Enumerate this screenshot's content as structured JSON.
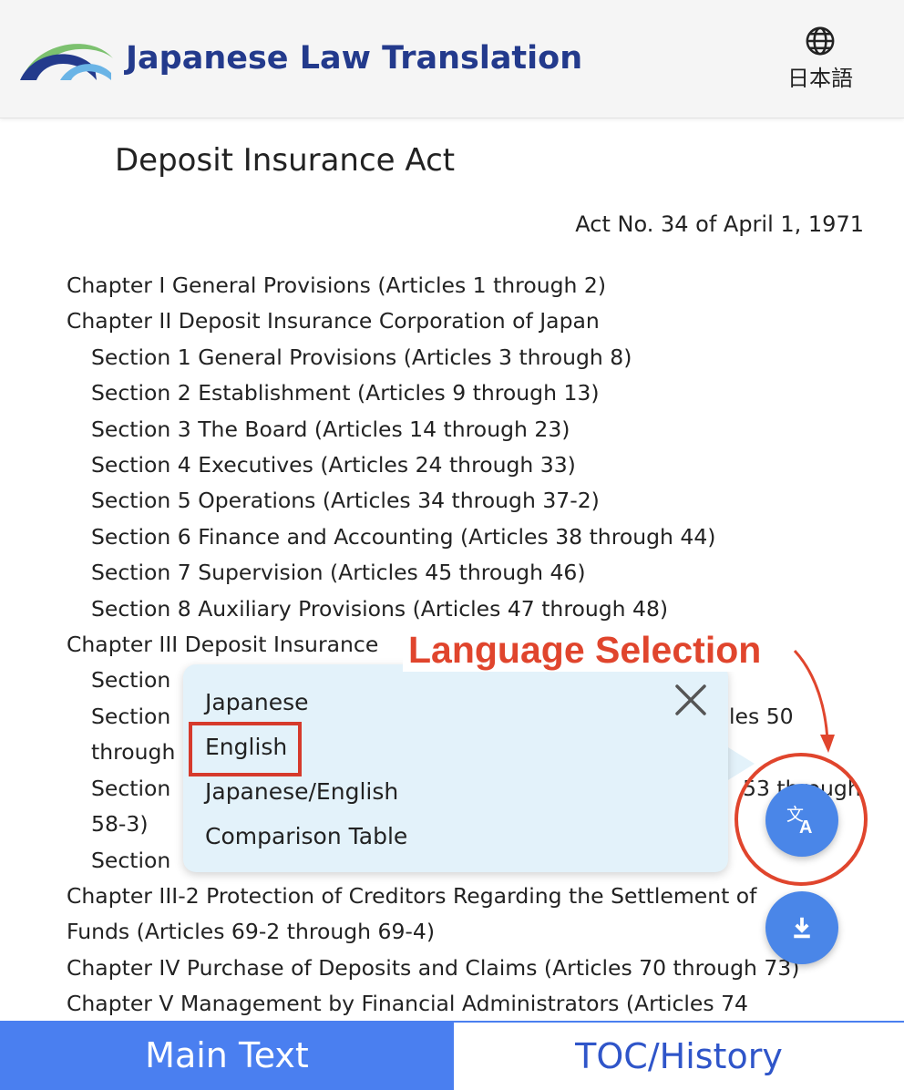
{
  "header": {
    "brand": "Japanese Law Translation",
    "language_link": "日本語",
    "logo_icon": "jlt-logo",
    "globe_icon": "globe-icon"
  },
  "document": {
    "title": "Deposit Insurance Act",
    "act_number": "Act No. 34 of April 1, 1971"
  },
  "toc": [
    "Chapter I General Provisions (Articles 1 through 2)",
    "Chapter II Deposit Insurance Corporation of Japan",
    "Section 1 General Provisions (Articles 3 through 8)",
    "Section 2 Establishment (Articles 9 through 13)",
    "Section 3 The Board (Articles 14 through 23)",
    "Section 4 Executives (Articles 24 through 33)",
    "Section 5 Operations (Articles 34 through 37-2)",
    "Section 6 Finance and Accounting (Articles 38 through 44)",
    "Section 7 Supervision (Articles 45 through 46)",
    "Section 8 Auxiliary Provisions (Articles 47 through 48)",
    "Chapter III Deposit Insurance",
    "Section",
    "Section",
    "les 50",
    "through",
    "Section",
    "53 through",
    "58-3)",
    "Section",
    "Chapter III-2 Protection of Creditors Regarding the Settlement of",
    "Funds (Articles 69-2 through 69-4)",
    "Chapter IV Purchase of Deposits and Claims (Articles 70 through 73)",
    "Chapter V Management by Financial Administrators (Articles 74"
  ],
  "annotation": {
    "label": "Language Selection"
  },
  "language_popup": {
    "options": [
      "Japanese",
      "English",
      "Japanese/English",
      "Comparison Table"
    ],
    "selected": "English",
    "close_icon": "close-icon"
  },
  "fabs": {
    "translate_icon": "translate-icon",
    "download_icon": "download-icon"
  },
  "tabs": {
    "main": "Main Text",
    "toc": "TOC/History"
  },
  "colors": {
    "brand_blue": "#233a8c",
    "accent_blue": "#4a86e8",
    "annotation_red": "#e0452d",
    "popup_bg": "#e3f2fa"
  }
}
